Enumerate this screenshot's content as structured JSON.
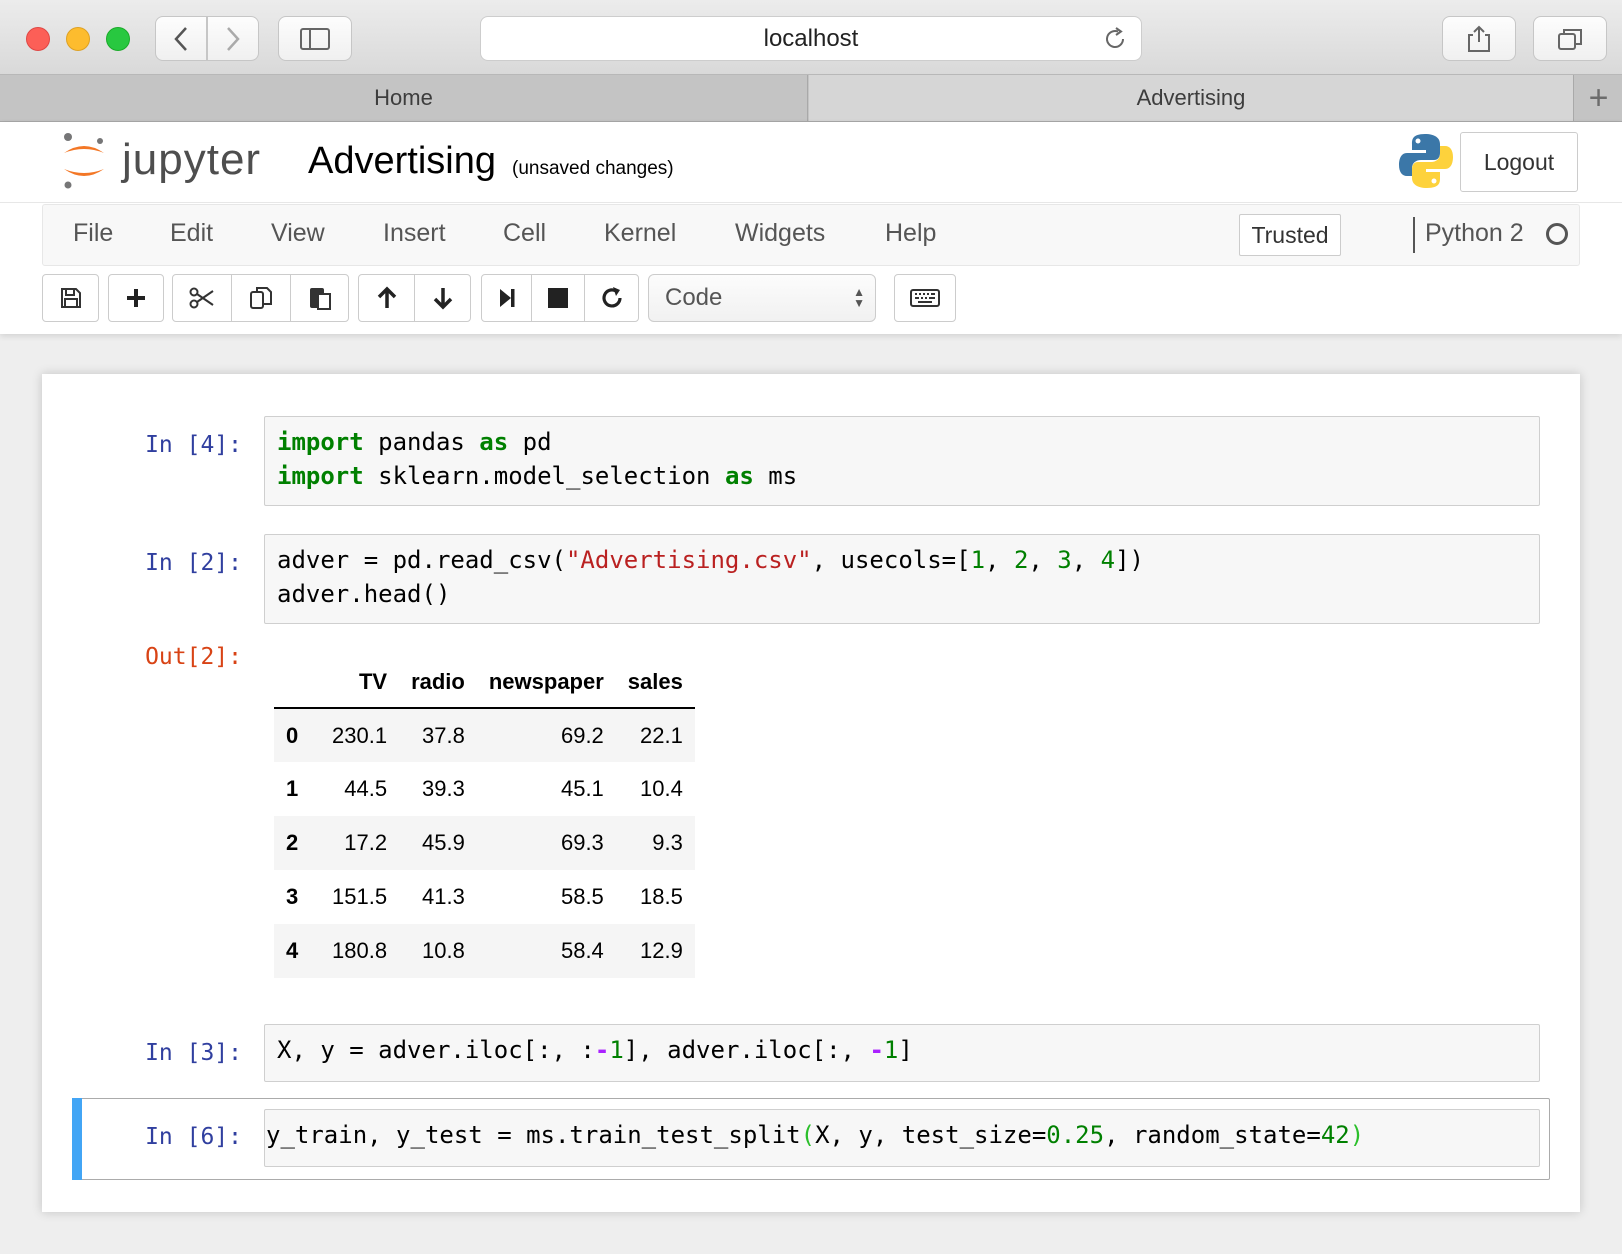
{
  "browser": {
    "url": "localhost",
    "tabs": [
      {
        "label": "Home",
        "active": false
      },
      {
        "label": "Advertising",
        "active": true
      }
    ]
  },
  "jupyter": {
    "logo_text": "jupyter",
    "notebook_title": "Advertising",
    "save_status": "(unsaved changes)",
    "logout_label": "Logout",
    "menu": [
      "File",
      "Edit",
      "View",
      "Insert",
      "Cell",
      "Kernel",
      "Widgets",
      "Help"
    ],
    "trusted_label": "Trusted",
    "kernel_name": "Python 2",
    "cell_type": "Code"
  },
  "cells": [
    {
      "prompt": "In [4]:"
    },
    {
      "prompt": "In [2]:",
      "output_prompt": "Out[2]:"
    },
    {
      "prompt": "In [3]:"
    },
    {
      "prompt": "In [6]:",
      "selected": true
    }
  ],
  "code": {
    "c1_l1_kw1": "import",
    "c1_l1_mod": " pandas ",
    "c1_l1_kw2": "as",
    "c1_l1_alias": " pd",
    "c1_l2_kw1": "import",
    "c1_l2_mod": " sklearn.model_selection ",
    "c1_l2_kw2": "as",
    "c1_l2_alias": " ms",
    "c2_l1_a": "adver = pd.read_csv(",
    "c2_l1_str": "\"Advertising.csv\"",
    "c2_l1_b": ", usecols=[",
    "c2_l1_n1": "1",
    "c2_l1_n2": "2",
    "c2_l1_n3": "3",
    "c2_l1_n4": "4",
    "c2_l1_c": "])",
    "c2_l2": "adver.head()",
    "c3_a": "X, y = adver.iloc[:, :",
    "c3_op1": "-",
    "c3_n1": "1",
    "c3_b": "], adver.iloc[:, ",
    "c3_op2": "-",
    "c3_n2": "1",
    "c3_c": "]",
    "c4_a": "y_train, y_test = ms.train_test_split",
    "c4_p1": "(",
    "c4_b": "X, y, test_size=",
    "c4_n1": "0.25",
    "c4_c": ", random_state=",
    "c4_n2": "42",
    "c4_p2": ")"
  },
  "dataframe": {
    "columns": [
      "TV",
      "radio",
      "newspaper",
      "sales"
    ],
    "rows": [
      {
        "index": "0",
        "TV": "230.1",
        "radio": "37.8",
        "newspaper": "69.2",
        "sales": "22.1"
      },
      {
        "index": "1",
        "TV": "44.5",
        "radio": "39.3",
        "newspaper": "45.1",
        "sales": "10.4"
      },
      {
        "index": "2",
        "TV": "17.2",
        "radio": "45.9",
        "newspaper": "69.3",
        "sales": "9.3"
      },
      {
        "index": "3",
        "TV": "151.5",
        "radio": "41.3",
        "newspaper": "58.5",
        "sales": "18.5"
      },
      {
        "index": "4",
        "TV": "180.8",
        "radio": "10.8",
        "newspaper": "58.4",
        "sales": "12.9"
      }
    ]
  },
  "colors": {
    "keyword": "#008000",
    "string": "#ba2121",
    "in_prompt": "#303f9f",
    "out_prompt": "#d84315",
    "selected_cell_bar": "#42a5f5"
  }
}
